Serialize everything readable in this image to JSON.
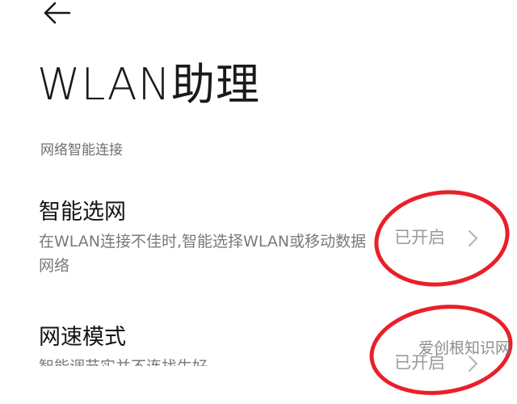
{
  "header": {
    "back_icon": "back-arrow-icon",
    "title": "WLAN助理"
  },
  "section": {
    "title": "网络智能连接"
  },
  "items": [
    {
      "title": "智能选网",
      "description": "在WLAN连接不佳时,智能选择WLAN或移动数据网络",
      "status": "已开启"
    },
    {
      "title": "网速模式",
      "description": "智能调节实并不连找生好",
      "status": "已开启"
    }
  ],
  "annotation": {
    "color": "#e8202a"
  },
  "watermark": "爱创根知识网"
}
